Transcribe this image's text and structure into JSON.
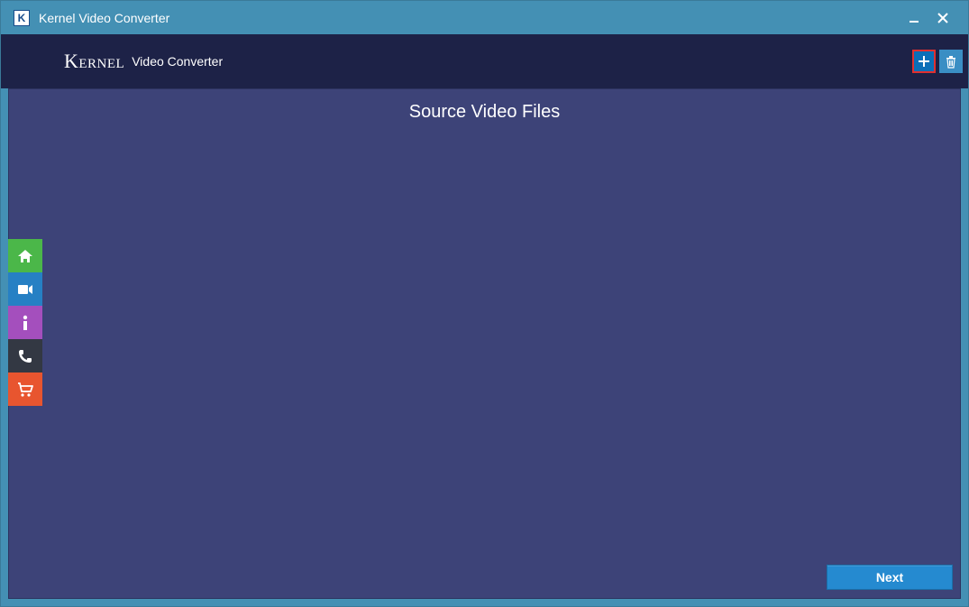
{
  "window": {
    "title": "Kernel Video Converter"
  },
  "header": {
    "brand": "Kernel",
    "subtitle": "Video Converter"
  },
  "content": {
    "title": "Source Video Files"
  },
  "buttons": {
    "next": "Next"
  },
  "icons": {
    "add": "plus-icon",
    "delete": "trash-icon",
    "minimize": "minimize-icon",
    "close": "close-icon"
  },
  "sidebar": {
    "items": [
      {
        "name": "home",
        "color": "#4bb749"
      },
      {
        "name": "video",
        "color": "#2680c4"
      },
      {
        "name": "info",
        "color": "#a44fbd"
      },
      {
        "name": "phone",
        "color": "#333843"
      },
      {
        "name": "cart",
        "color": "#e8552f"
      }
    ]
  }
}
